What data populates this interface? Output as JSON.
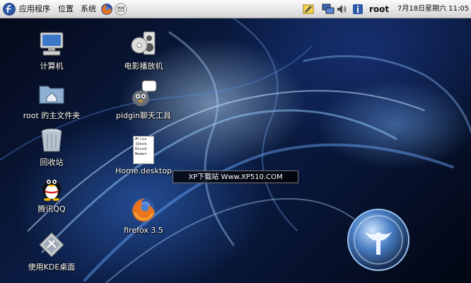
{
  "panel": {
    "menu_applications": "应用程序",
    "menu_places": "位置",
    "menu_system": "系统",
    "user": "root",
    "clock": "7月18日星期六 11:05",
    "icons": [
      "fedora-menu-icon",
      "firefox-launcher-icon",
      "email-launcher-icon",
      "notes-icon",
      "network-icon",
      "volume-icon",
      "info-icon"
    ]
  },
  "desktop": {
    "icons": [
      {
        "name": "computer",
        "label": "计算机",
        "icon": "computer-icon"
      },
      {
        "name": "home-folder",
        "label": "root 的主文件夹",
        "icon": "home-folder-icon"
      },
      {
        "name": "trash",
        "label": "回收站",
        "icon": "trash-icon"
      },
      {
        "name": "qq",
        "label": "腾讯QQ",
        "icon": "penguin-icon"
      },
      {
        "name": "kde-desktop",
        "label": "使用KDE桌面",
        "icon": "kde-icon"
      },
      {
        "name": "movie-player",
        "label": "电影播放机",
        "icon": "movie-player-icon"
      },
      {
        "name": "pidgin",
        "label": "pidgin聊天工具",
        "icon": "pidgin-icon"
      },
      {
        "name": "home-desktop",
        "label": "Home.desktop",
        "icon": "desktop-file-icon",
        "file_preview": "#!/us\n[Desk\nEncod\nName="
      },
      {
        "name": "firefox",
        "label": "firefox 3.5",
        "icon": "firefox-icon"
      }
    ]
  },
  "watermark": "XP下载站  Www.XP510.COM",
  "colors": {
    "panel": "#e4e4e4",
    "desktop": "#0b1e48",
    "accent": "#4aa0ff"
  }
}
